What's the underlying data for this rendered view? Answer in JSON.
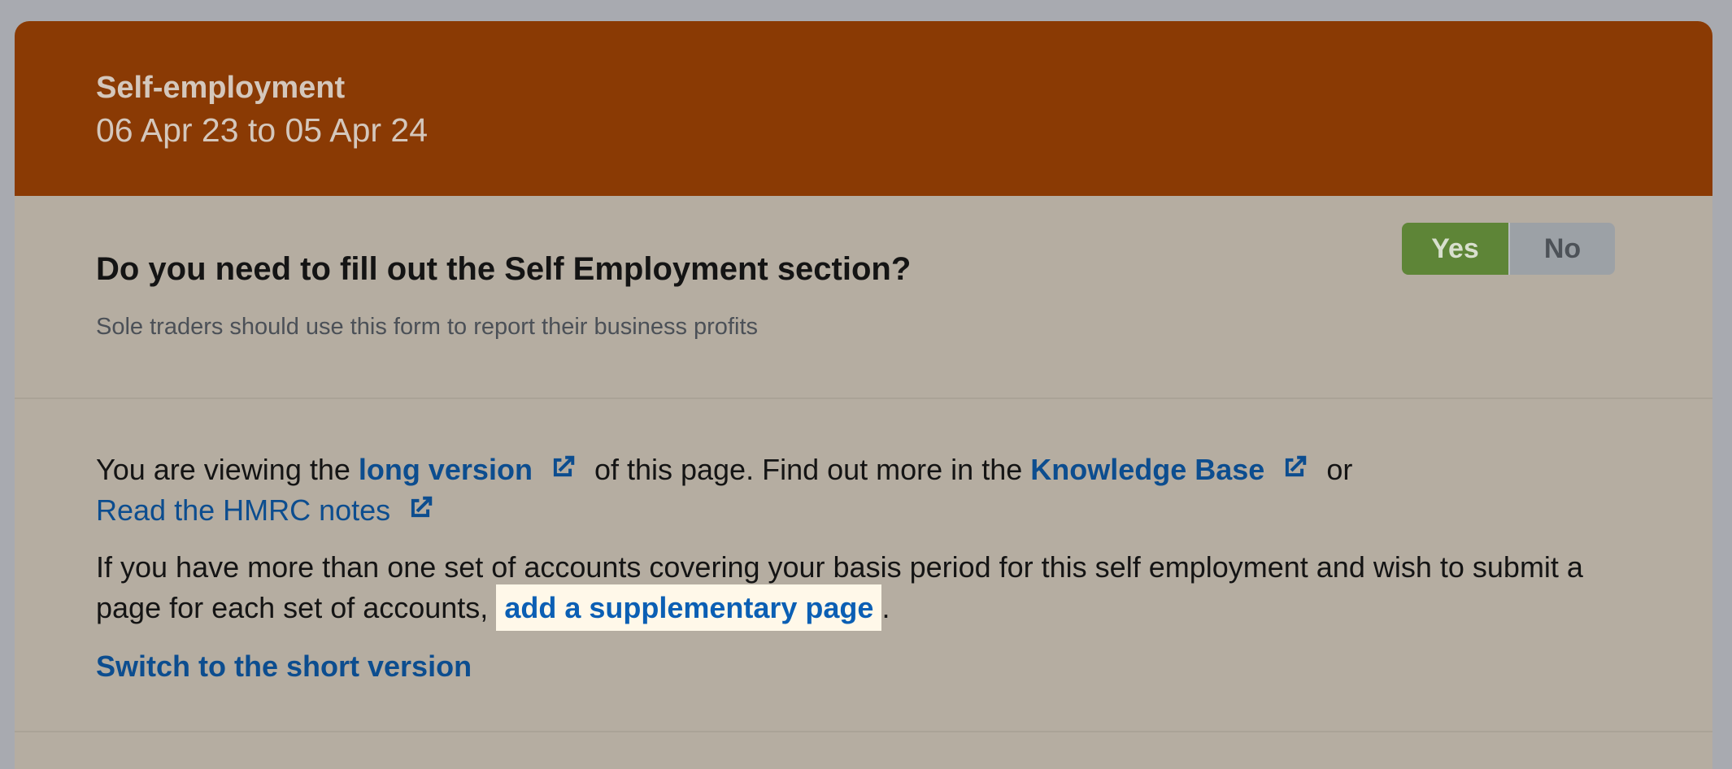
{
  "header": {
    "section_name": "Self-employment",
    "period": "06 Apr 23 to 05 Apr 24"
  },
  "question": {
    "text": "Do you need to fill out the Self Employment section?",
    "hint": "Sole traders should use this form to report their business profits",
    "yes_label": "Yes",
    "no_label": "No",
    "selected": "Yes"
  },
  "info": {
    "line1_prefix": "You are viewing the ",
    "long_version_link": "long version",
    "line1_middle": " of this page. Find out more in the ",
    "knowledge_base_link": "Knowledge Base",
    "line1_suffix": " or",
    "hmrc_notes_link": "Read the HMRC notes",
    "para2_text": "If you have more than one set of accounts covering your basis period for this self employment and wish to submit a page for each set of accounts, ",
    "supplementary_link": "add a supplementary page",
    "para2_end": ".",
    "switch_link": "Switch to the short version"
  },
  "icons": {
    "external_link": "external-link-icon"
  },
  "colors": {
    "header_bg": "#8a3a04",
    "panel_bg": "#b5ada1",
    "yes_active": "#5e8537",
    "no_inactive": "#9ca1a6",
    "link": "#0c4d8f",
    "highlight_bg": "#fff8e9"
  }
}
